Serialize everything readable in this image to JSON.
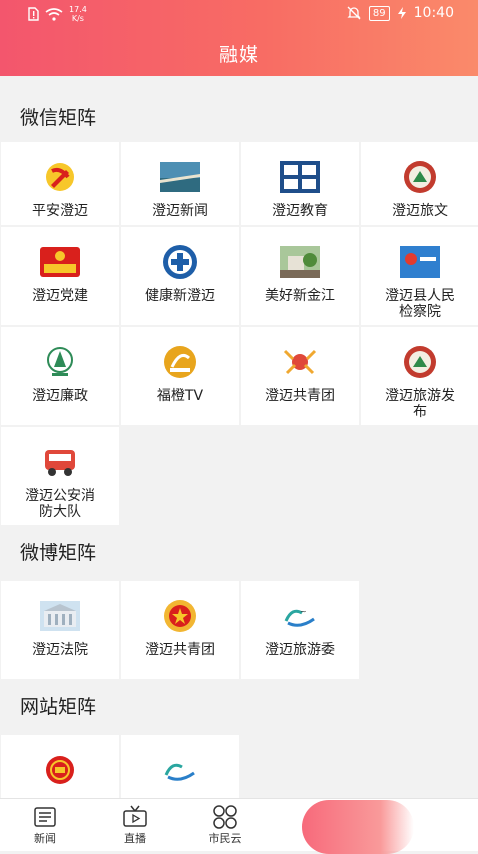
{
  "status": {
    "speed": "17.4",
    "speed_unit": "K/s",
    "battery": "89",
    "time": "10:40"
  },
  "header": {
    "title": "融媒"
  },
  "sections": [
    {
      "title": "微信矩阵",
      "items": [
        {
          "label": "平安澄迈",
          "icon": "party-emblem-icon"
        },
        {
          "label": "澄迈新闻",
          "icon": "news-photo-icon"
        },
        {
          "label": "澄迈教育",
          "icon": "education-logo-icon"
        },
        {
          "label": "澄迈旅文",
          "icon": "tourism-badge-icon"
        },
        {
          "label": "澄迈党建",
          "icon": "party-building-icon"
        },
        {
          "label": "健康新澄迈",
          "icon": "health-seal-icon"
        },
        {
          "label": "美好新金江",
          "icon": "town-photo-icon"
        },
        {
          "label": "澄迈县人民检察院",
          "icon": "procuratorate-icon"
        },
        {
          "label": "澄迈廉政",
          "icon": "integrity-logo-icon"
        },
        {
          "label": "福橙TV",
          "icon": "cmtv-logo-icon"
        },
        {
          "label": "澄迈共青团",
          "icon": "youth-league-icon"
        },
        {
          "label": "澄迈旅游发布",
          "icon": "tourism-badge-icon"
        },
        {
          "label": "澄迈公安消防大队",
          "icon": "fire-truck-icon"
        }
      ]
    },
    {
      "title": "微博矩阵",
      "items": [
        {
          "label": "澄迈法院",
          "icon": "court-building-icon"
        },
        {
          "label": "澄迈共青团",
          "icon": "youth-league-badge-icon"
        },
        {
          "label": "澄迈旅游委",
          "icon": "tourism-bureau-icon"
        }
      ]
    },
    {
      "title": "网站矩阵",
      "items": [
        {
          "label": "",
          "icon": "national-emblem-icon"
        },
        {
          "label": "",
          "icon": "tourism-bureau-icon"
        }
      ]
    }
  ],
  "tabbar": [
    {
      "label": "新闻",
      "icon": "news-icon"
    },
    {
      "label": "直播",
      "icon": "tv-icon"
    },
    {
      "label": "市民云",
      "icon": "grid-circles-icon"
    }
  ],
  "colors": {
    "header_start": "#f3566d",
    "header_end": "#fa8a6a",
    "party_red": "#d9201c"
  }
}
